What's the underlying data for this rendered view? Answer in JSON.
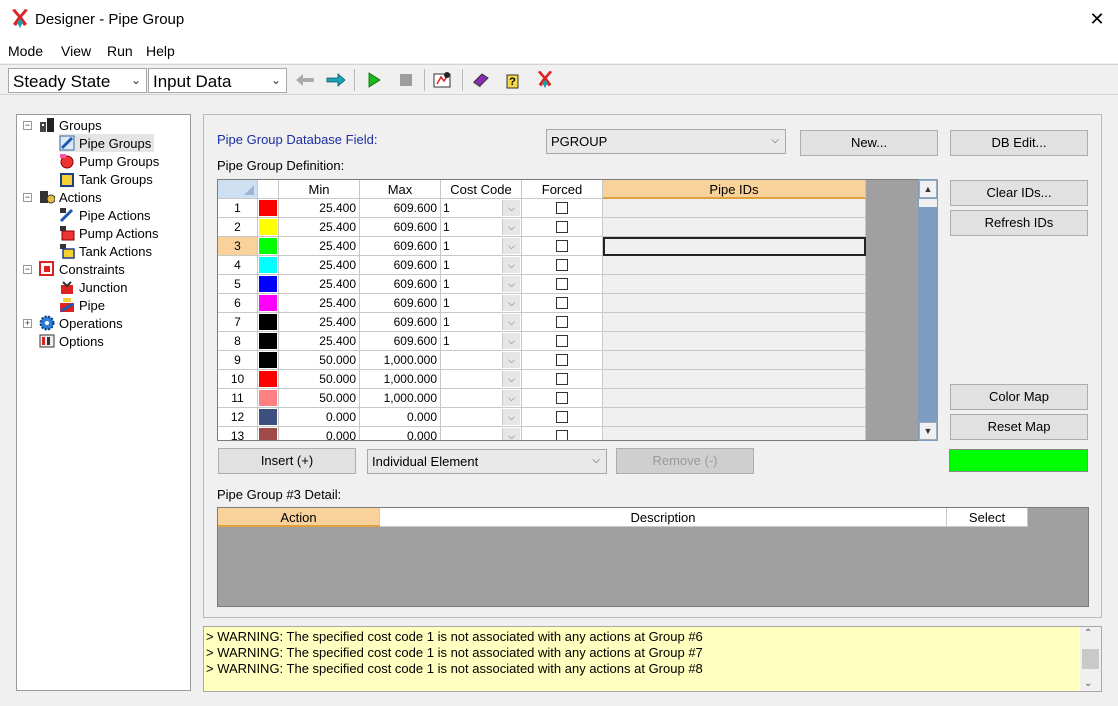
{
  "window": {
    "title": "Designer - Pipe Group",
    "close_glyph": "✕"
  },
  "menu": [
    "Mode",
    "View",
    "Run",
    "Help"
  ],
  "toolbar": {
    "mode": "Steady State",
    "view": "Input Data",
    "icons": [
      "back-arrow-icon",
      "forward-arrow-icon",
      "run-icon",
      "stop-icon",
      "designer-graph-icon",
      "book-icon",
      "help-icon",
      "designer-icon"
    ]
  },
  "tree": [
    {
      "label": "Groups",
      "level": 0
    },
    {
      "label": "Pipe Groups",
      "level": 1,
      "selected": true
    },
    {
      "label": "Pump Groups",
      "level": 1
    },
    {
      "label": "Tank Groups",
      "level": 1
    },
    {
      "label": "Actions",
      "level": 0
    },
    {
      "label": "Pipe Actions",
      "level": 1
    },
    {
      "label": "Pump Actions",
      "level": 1
    },
    {
      "label": "Tank Actions",
      "level": 1
    },
    {
      "label": "Constraints",
      "level": 0
    },
    {
      "label": "Junction",
      "level": 1
    },
    {
      "label": "Pipe",
      "level": 1
    },
    {
      "label": "Operations",
      "level": 0
    },
    {
      "label": "Options",
      "level": 0
    }
  ],
  "db_field": {
    "label": "Pipe Group Database Field:",
    "value": "PGROUP"
  },
  "buttons": {
    "new": "New...",
    "db_edit": "DB Edit...",
    "clear_ids": "Clear IDs...",
    "refresh_ids": "Refresh IDs",
    "color_map": "Color Map",
    "reset_map": "Reset Map",
    "insert": "Insert (+)",
    "remove": "Remove (-)"
  },
  "definition_label": "Pipe Group Definition:",
  "grid": {
    "columns": [
      "Min",
      "Max",
      "Cost Code",
      "Forced",
      "Pipe IDs"
    ],
    "selected_row": 3,
    "rows": [
      {
        "n": "1",
        "color": "#ff0000",
        "min": "25.400",
        "max": "609.600",
        "cc": "1"
      },
      {
        "n": "2",
        "color": "#ffff00",
        "min": "25.400",
        "max": "609.600",
        "cc": "1"
      },
      {
        "n": "3",
        "color": "#00ff00",
        "min": "25.400",
        "max": "609.600",
        "cc": "1"
      },
      {
        "n": "4",
        "color": "#00ffff",
        "min": "25.400",
        "max": "609.600",
        "cc": "1"
      },
      {
        "n": "5",
        "color": "#0000ff",
        "min": "25.400",
        "max": "609.600",
        "cc": "1"
      },
      {
        "n": "6",
        "color": "#ff00ff",
        "min": "25.400",
        "max": "609.600",
        "cc": "1"
      },
      {
        "n": "7",
        "color": "#000000",
        "min": "25.400",
        "max": "609.600",
        "cc": "1"
      },
      {
        "n": "8",
        "color": "#000000",
        "min": "25.400",
        "max": "609.600",
        "cc": "1"
      },
      {
        "n": "9",
        "color": "#000000",
        "min": "50.000",
        "max": "1,000.000",
        "cc": ""
      },
      {
        "n": "10",
        "color": "#ff0000",
        "min": "50.000",
        "max": "1,000.000",
        "cc": ""
      },
      {
        "n": "11",
        "color": "#ff8080",
        "min": "50.000",
        "max": "1,000.000",
        "cc": ""
      },
      {
        "n": "12",
        "color": "#3c4f7e",
        "min": "0.000",
        "max": "0.000",
        "cc": ""
      },
      {
        "n": "13",
        "color": "#a04a4a",
        "min": "0.000",
        "max": "0.000",
        "cc": ""
      }
    ]
  },
  "element_mode": "Individual Element",
  "color_swatch": "#00ff00",
  "detail": {
    "label": "Pipe Group #3 Detail:",
    "columns": [
      "Action",
      "Description",
      "Select"
    ]
  },
  "log": [
    "> WARNING: The specified cost code 1 is not associated with any actions at Group #6",
    "> WARNING: The specified cost code 1 is not associated with any actions at Group #7",
    "> WARNING: The specified cost code 1 is not associated with any actions at Group #8"
  ]
}
